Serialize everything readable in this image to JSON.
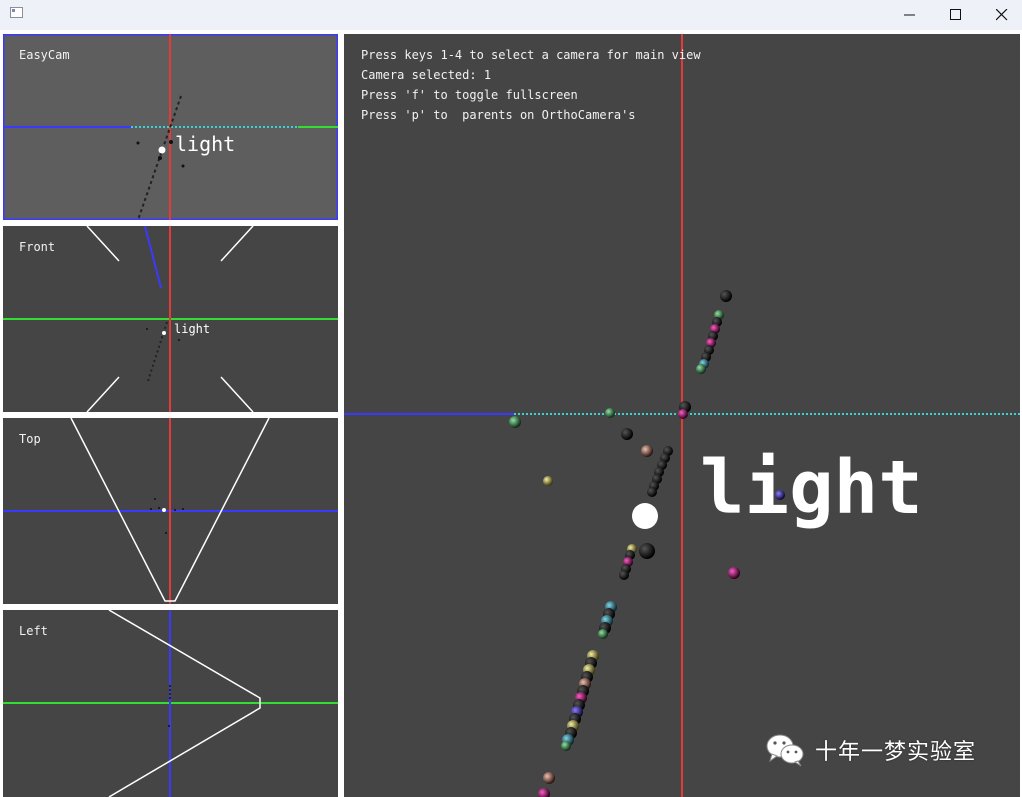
{
  "window": {
    "icons": {
      "app": "app-window-icon",
      "minimize": "minimize-icon",
      "maximize": "maximize-icon",
      "close": "close-icon"
    }
  },
  "views": {
    "easycam": {
      "label": "EasyCam",
      "light_label": "light"
    },
    "front": {
      "label": "Front",
      "light_label": "light"
    },
    "top": {
      "label": "Top"
    },
    "left": {
      "label": "Left"
    }
  },
  "main_view": {
    "instructions": [
      "Press keys 1-4 to select a camera for main view",
      "Camera selected: 1",
      "Press 'f' to toggle fullscreen",
      "Press 'p' to  parents on OrthoCamera's"
    ],
    "light_label": "light"
  },
  "watermark": {
    "icon": "wechat-icon",
    "text": "十年一梦实验室"
  },
  "colors": {
    "view_bg": "#454545",
    "easycam_bg": "#5e5e5e",
    "axis_x": "#3a3aff",
    "axis_y": "#e33a3a",
    "axis_z": "#33dd33",
    "dotted": "#3ad3d3"
  }
}
